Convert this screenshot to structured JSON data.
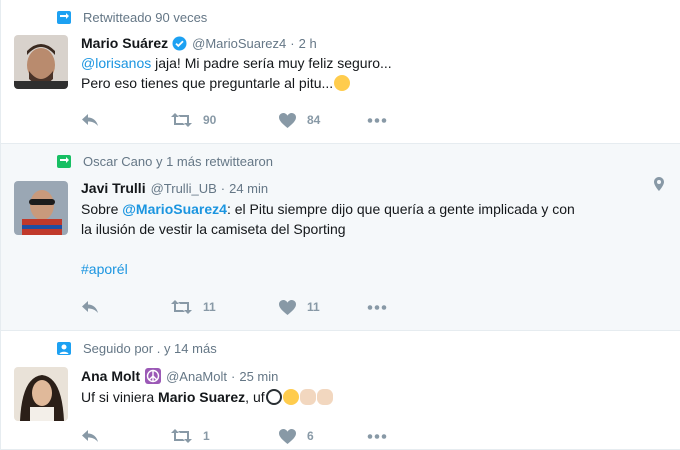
{
  "tweets": [
    {
      "context": "Retwitteado 90 veces",
      "fullname": "Mario Suárez",
      "handle": "@MarioSuarez4",
      "sep": "·",
      "time": "2 h",
      "body_mention": "@lorisanos",
      "body_text1": " jaja! Mi padre sería muy feliz seguro...",
      "body_text2": "Pero eso tienes que preguntarle al pitu...",
      "retweets": "90",
      "likes": "84"
    },
    {
      "context": "Oscar Cano y 1 más retwittearon",
      "fullname": "Javi Trulli",
      "handle": "@Trulli_UB",
      "sep": "·",
      "time": "24 min",
      "body_pre": "Sobre ",
      "body_mention": "@MarioSuarez4",
      "body_text1": ": el Pitu siempre dijo que quería a gente implicada y con",
      "body_text2": "la ilusión de vestir la camiseta del Sporting",
      "hashtag": "#aporél",
      "retweets": "11",
      "likes": "11"
    },
    {
      "context": "Seguido por . y 14 más",
      "fullname": "Ana Molt",
      "handle": "@AnaMolt",
      "sep": "·",
      "time": "25 min",
      "body_pre": "Uf si viniera ",
      "body_bold": "Mario Suarez",
      "body_post": ", uf",
      "retweets": "1",
      "likes": "6"
    }
  ],
  "icons": {
    "retweet_context": "retweet-icon",
    "follow_context": "person-icon",
    "verified": "verified-badge-icon",
    "peace": "peace-emoji-icon",
    "reply": "reply-icon",
    "retweet": "retweet-icon",
    "like": "heart-icon",
    "more": "more-icon",
    "location": "location-pin-icon"
  },
  "colors": {
    "link": "#1b95e0",
    "muted": "#657786",
    "action": "#8899a6",
    "highlight_bg": "#f5f8fa",
    "retweet_green": "#17bf63",
    "twitter_blue": "#1da1f2"
  }
}
